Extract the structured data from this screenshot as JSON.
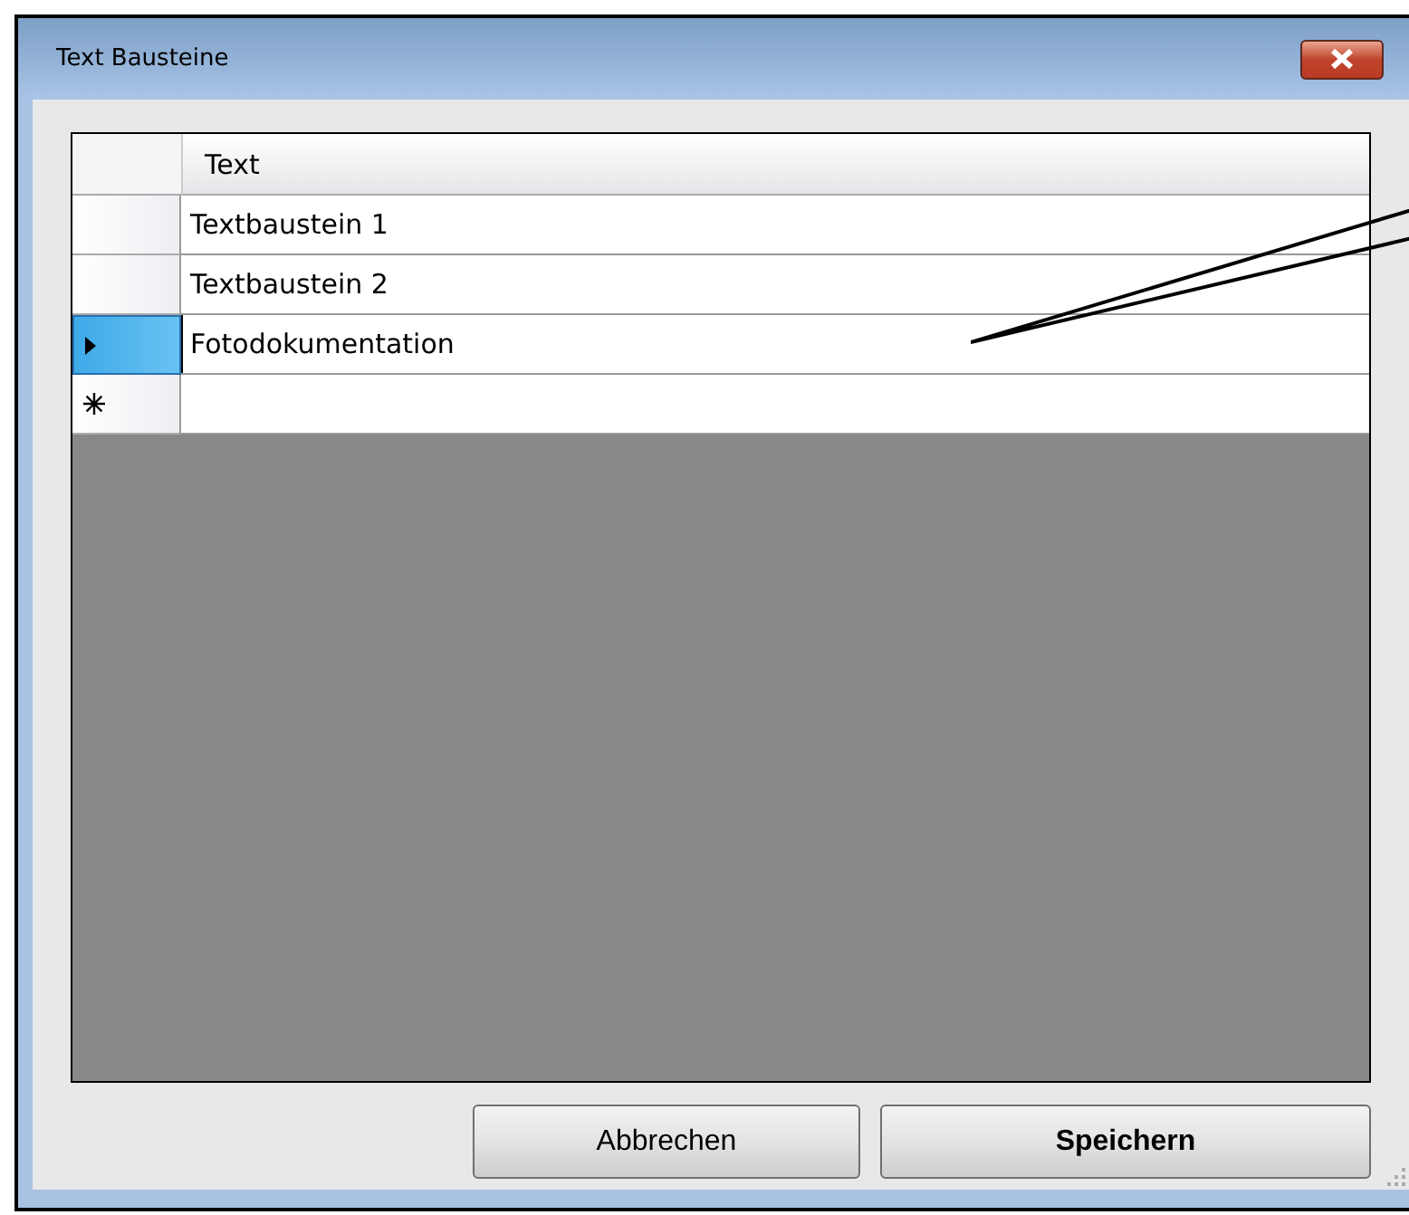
{
  "window": {
    "title": "Text Bausteine"
  },
  "table": {
    "columns": [
      "Text"
    ],
    "rows": [
      {
        "text": "Textbaustein 1",
        "selected": false
      },
      {
        "text": "Textbaustein 2",
        "selected": false
      },
      {
        "text": "Fotodokumentation",
        "selected": true
      }
    ]
  },
  "buttons": [
    {
      "label": "Abbrechen",
      "default": false
    },
    {
      "label": "Speichern",
      "default": true
    }
  ]
}
